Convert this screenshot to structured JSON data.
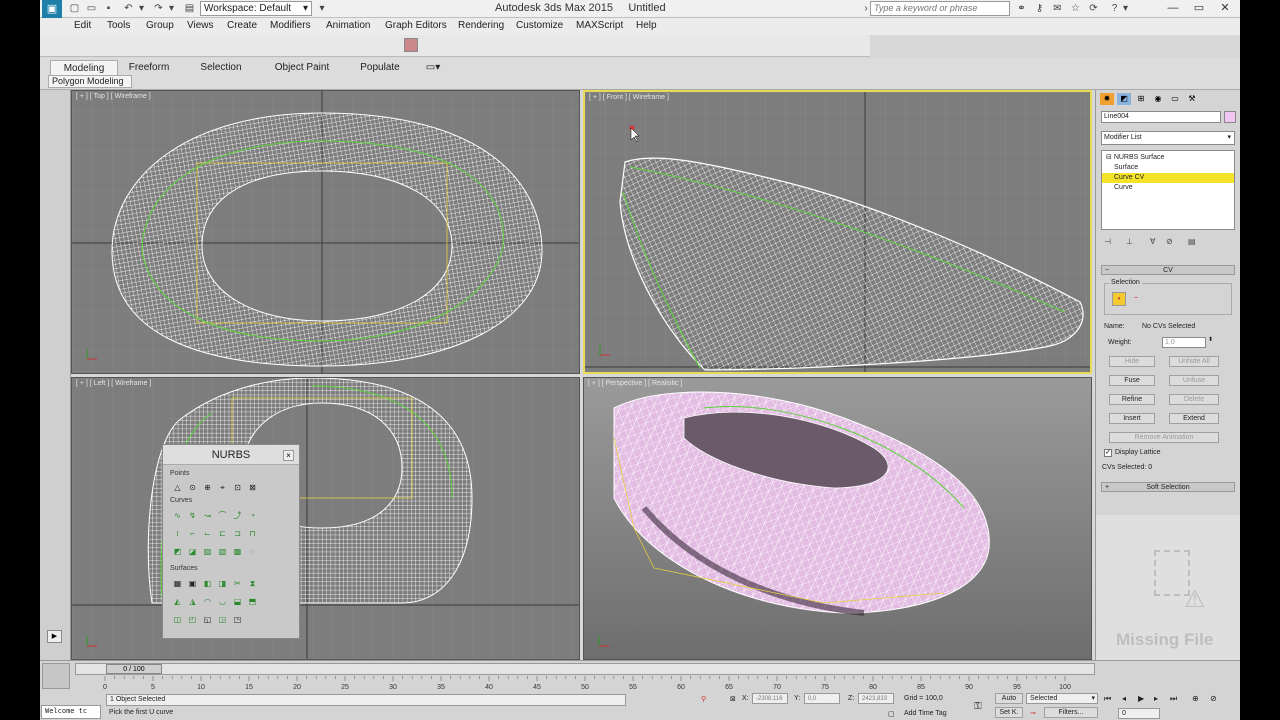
{
  "title": {
    "app_title": "Autodesk 3ds Max  2015",
    "doc_title": "Untitled",
    "workspace": "Workspace: Default",
    "search_placeholder": "Type a keyword or phrase"
  },
  "menu": [
    "Edit",
    "Tools",
    "Group",
    "Views",
    "Create",
    "Modifiers",
    "Animation",
    "Graph Editors",
    "Rendering",
    "Customize",
    "MAXScript",
    "Help"
  ],
  "ribbon": {
    "tabs": [
      "Modeling",
      "Freeform",
      "Selection",
      "Object Paint",
      "Populate"
    ],
    "active_tab": "Modeling",
    "panel": "Polygon Modeling"
  },
  "viewports": {
    "top": "[ + ] [ Top ] [ Wireframe ]",
    "front": "[ + ] [ Front ] [ Wireframe ]",
    "left": "[ + ] [ Left ] [ Wireframe ]",
    "perspective": "[ + ] [ Perspective ] [ Realistic ]"
  },
  "nurbs": {
    "title": "NURBS",
    "close": "×",
    "sections": [
      "Points",
      "Curves",
      "Surfaces"
    ]
  },
  "cmd": {
    "object_name": "Line004",
    "modifier_list": "Modifier List",
    "stack": [
      "NURBS Surface",
      "Surface",
      "Curve CV",
      "Curve"
    ],
    "selected_stack": "Curve CV",
    "rollout_cv": "CV",
    "selection_label": "Selection",
    "name_label": "Name:",
    "name_value": "No CVs Selected",
    "weight_label": "Weight:",
    "weight_value": "1,0",
    "buttons": {
      "hide": "Hide",
      "unhide_all": "Unhide All",
      "fuse": "Fuse",
      "unfuse": "Unfuse",
      "refine": "Refine",
      "delete": "Delete",
      "insert": "Insert",
      "extend": "Extend",
      "remove_animation": "Remove Animation"
    },
    "display_lattice": "Display Lattice",
    "cvs_selected": "CVs Selected: 0",
    "soft_selection": "Soft Selection",
    "missing_file": "Missing File"
  },
  "timeline": {
    "frame": "0 / 100",
    "ticks": [
      "0",
      "5",
      "10",
      "15",
      "20",
      "25",
      "30",
      "35",
      "40",
      "45",
      "50",
      "55",
      "60",
      "65",
      "70",
      "75",
      "80",
      "85",
      "90",
      "95",
      "100"
    ]
  },
  "status": {
    "maxscript": "Welcome tc",
    "objects_selected": "1 Object Selected",
    "prompt": "Pick the first U curve",
    "x_label": "X:",
    "x_value": "-2308,116",
    "y_label": "Y:",
    "y_value": "0,0",
    "z_label": "Z:",
    "z_value": "2423,833",
    "grid": "Grid = 100,0",
    "add_time_tag": "Add Time Tag",
    "auto": "Auto",
    "set_k": "Set K.",
    "selected": "Selected",
    "filters": "Filters...",
    "frame_field": "0"
  },
  "colors": {
    "accent": "#f5e32a",
    "viewport_bg": "#7d7d7d",
    "wire": "#ffffff",
    "lattice": "#5bd33a",
    "mesh": "#e3bce3"
  }
}
